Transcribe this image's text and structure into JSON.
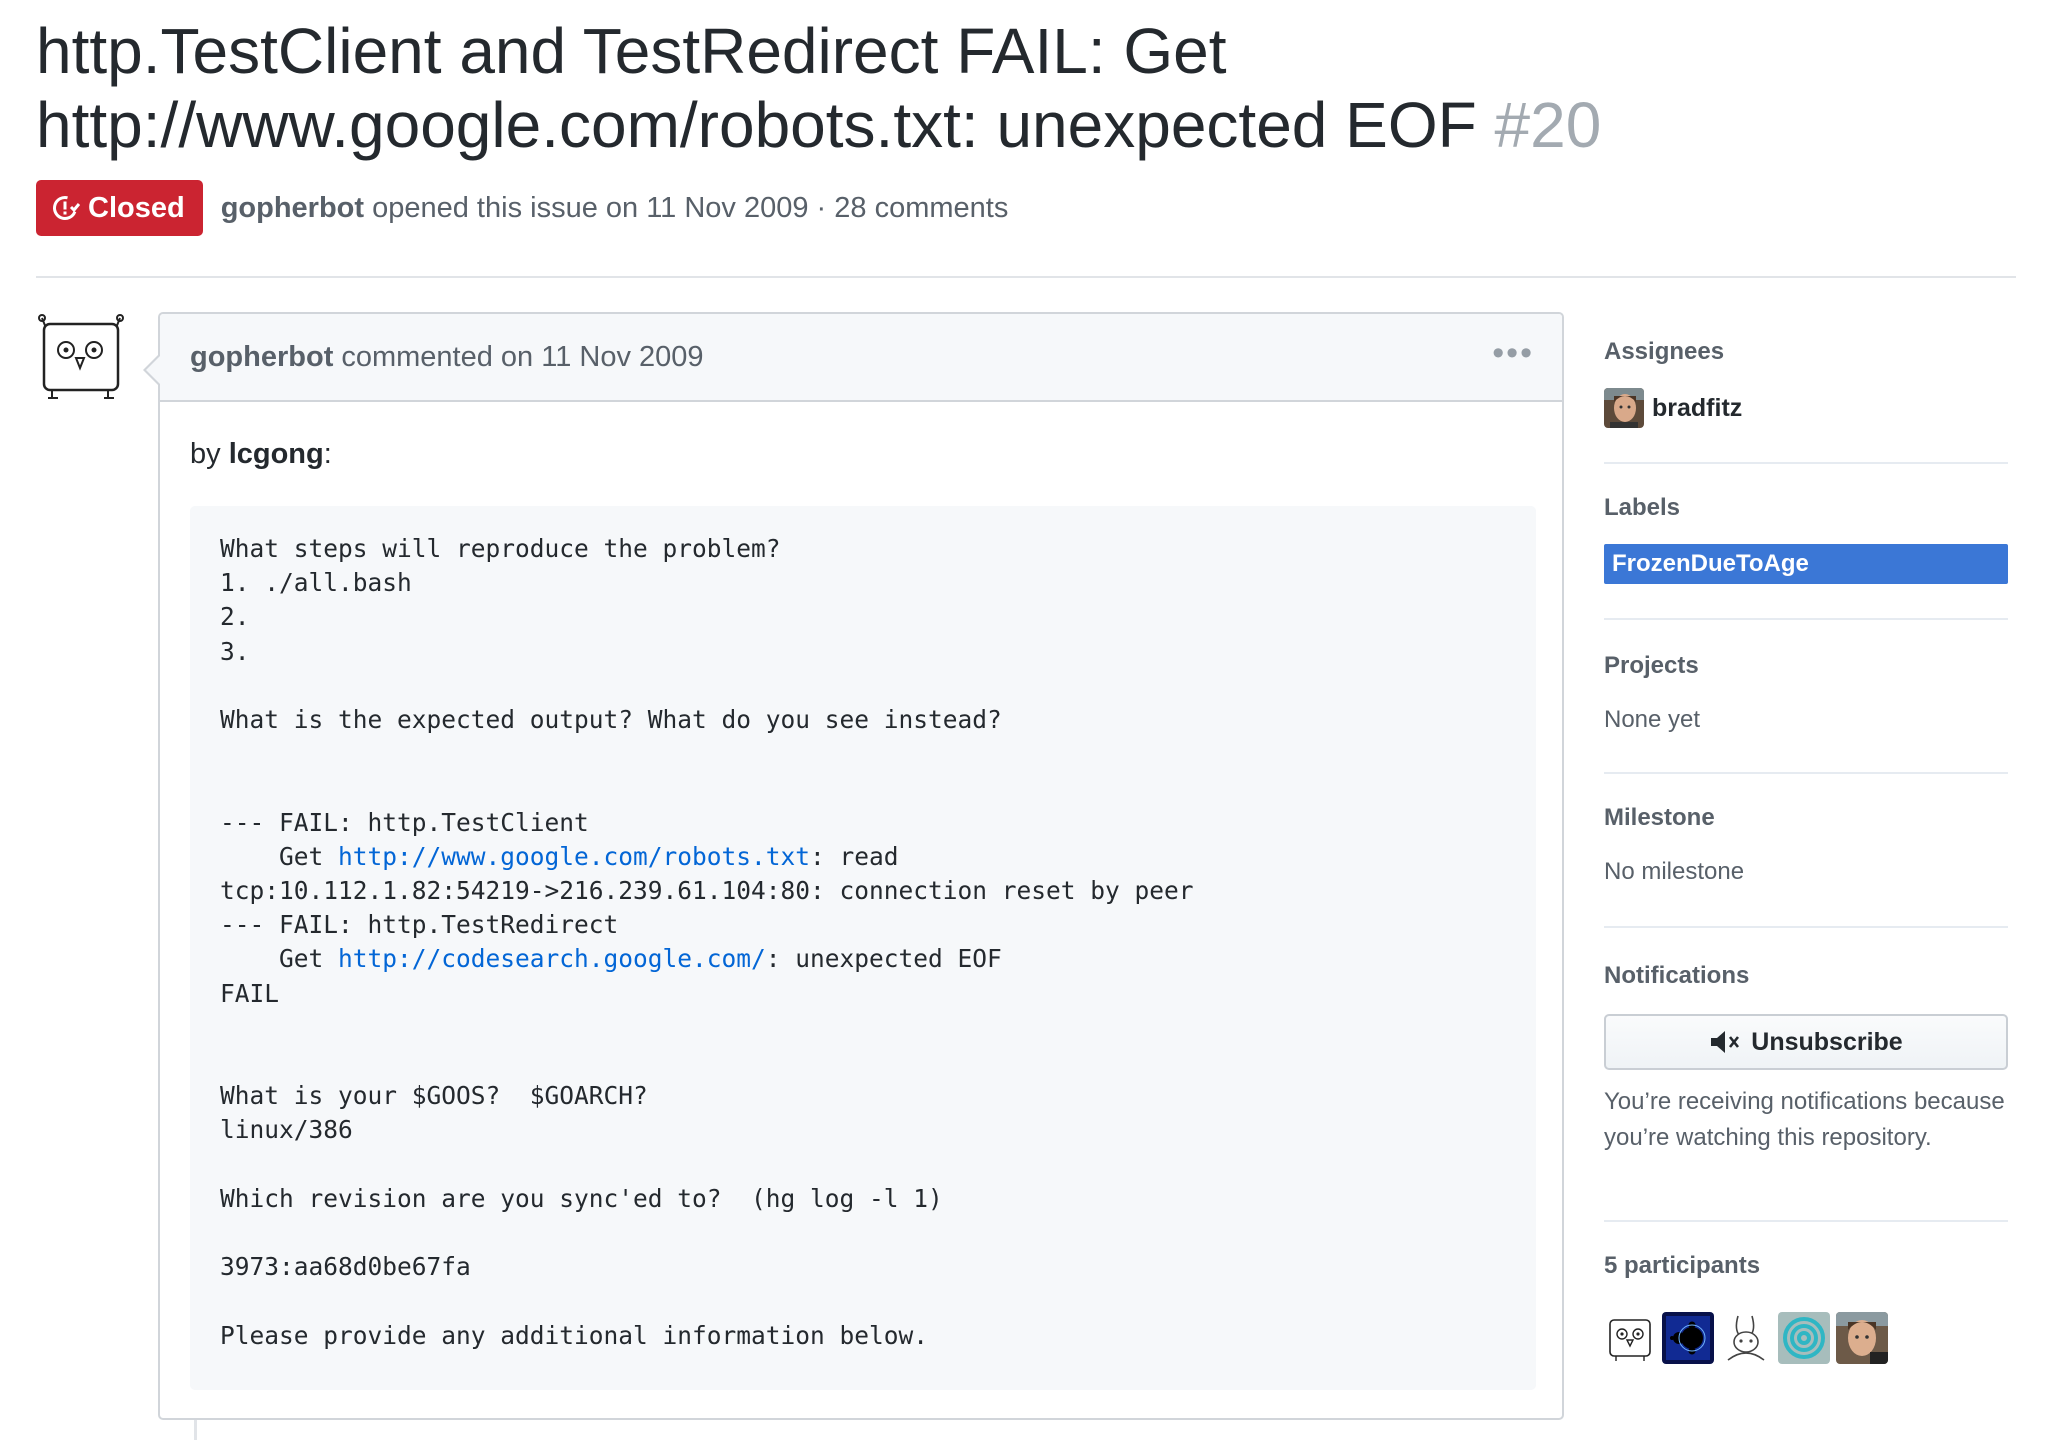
{
  "issue": {
    "title": "http.TestClient and TestRedirect FAIL: Get http://www.google.com/robots.txt: unexpected EOF",
    "number": "#20",
    "state": "Closed",
    "author": "gopherbot",
    "opened_text": "opened this issue on 11 Nov 2009 · 28 comments"
  },
  "comment": {
    "author": "gopherbot",
    "meta": "commented on 11 Nov 2009",
    "menu_icon": "kebab-horizontal-icon",
    "by_prefix": "by ",
    "by_author": "lcgong",
    "by_suffix": ":",
    "code": {
      "l1": "What steps will reproduce the problem?",
      "l2": "1. ./all.bash",
      "l3": "2.",
      "l4": "3.",
      "l5": "What is the expected output? What do you see instead?",
      "l6": "--- FAIL: http.TestClient",
      "l7_pre": "    Get ",
      "l7_link": "http://www.google.com/robots.txt",
      "l7_post": ": read",
      "l8": "tcp:10.112.1.82:54219->216.239.61.104:80: connection reset by peer",
      "l9": "--- FAIL: http.TestRedirect",
      "l10_pre": "    Get ",
      "l10_link": "http://codesearch.google.com/",
      "l10_post": ": unexpected EOF",
      "l11": "FAIL",
      "l12": "What is your $GOOS?  $GOARCH?",
      "l13": "linux/386",
      "l14": "Which revision are you sync'ed to?  (hg log -l 1)",
      "l15": "3973:aa68d0be67fa",
      "l16": "Please provide any additional information below."
    }
  },
  "sidebar": {
    "assignees": {
      "heading": "Assignees",
      "user": "bradfitz"
    },
    "labels": {
      "heading": "Labels",
      "items": [
        "FrozenDueToAge"
      ],
      "color": "#3b77d6"
    },
    "projects": {
      "heading": "Projects",
      "value": "None yet"
    },
    "milestone": {
      "heading": "Milestone",
      "value": "No milestone"
    },
    "notifications": {
      "heading": "Notifications",
      "button": "Unsubscribe",
      "button_icon": "mute-icon",
      "reason": "You’re receiving notifications because you’re watching this repository."
    },
    "participants": {
      "heading": "5 participants",
      "avatars": [
        "gopher-avatar",
        "fractal-avatar",
        "rabbit-avatar",
        "spiral-avatar",
        "man-avatar"
      ]
    }
  },
  "colors": {
    "closed": "#cb2431",
    "link": "#0366d6",
    "label": "#3b77d6",
    "muted": "#586069"
  }
}
